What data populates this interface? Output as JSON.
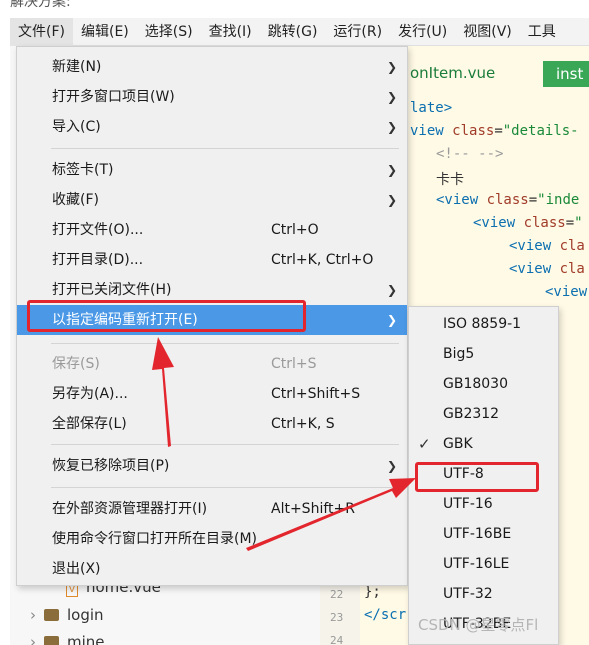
{
  "caption": "解决方案:",
  "menubar": [
    "文件(F)",
    "编辑(E)",
    "选择(S)",
    "查找(I)",
    "跳转(G)",
    "运行(R)",
    "发行(U)",
    "视图(V)",
    "工具"
  ],
  "editor": {
    "tab_title": "onItem.vue",
    "green_button": "inst",
    "code_lines": [
      {
        "parts": [
          {
            "c": "tag",
            "t": "late>"
          }
        ]
      },
      {
        "parts": [
          {
            "c": "tag",
            "t": "view "
          },
          {
            "c": "attr",
            "t": "class"
          },
          {
            "c": "plain",
            "t": "="
          },
          {
            "c": "str",
            "t": "\"details-"
          }
        ]
      },
      {
        "parts": [
          {
            "c": "cmt",
            "t": "<!--  -->"
          }
        ]
      },
      {
        "parts": [
          {
            "c": "plain",
            "t": "卡卡"
          }
        ]
      },
      {
        "parts": [
          {
            "c": "tag",
            "t": "<view "
          },
          {
            "c": "attr",
            "t": "class"
          },
          {
            "c": "plain",
            "t": "="
          },
          {
            "c": "str",
            "t": "\"inde"
          }
        ]
      },
      {
        "parts": [
          {
            "c": "tag",
            "t": "<view "
          },
          {
            "c": "attr",
            "t": "class"
          },
          {
            "c": "plain",
            "t": "="
          },
          {
            "c": "str",
            "t": "\""
          }
        ]
      },
      {
        "parts": [
          {
            "c": "tag",
            "t": "<view "
          },
          {
            "c": "attr",
            "t": "cla"
          }
        ]
      },
      {
        "parts": [
          {
            "c": "tag",
            "t": "<view "
          },
          {
            "c": "attr",
            "t": "cla"
          }
        ]
      },
      {
        "parts": [
          {
            "c": "tag",
            "t": "<view"
          }
        ]
      },
      {
        "parts": [
          {
            "c": "tag",
            "t": ">"
          }
        ]
      }
    ],
    "bottom_code": [
      {
        "num": "22",
        "text": "};"
      },
      {
        "num": "23",
        "text": "</scr"
      },
      {
        "num": "24",
        "text": ""
      }
    ]
  },
  "tree": {
    "file": "home.vue",
    "folders": [
      "login",
      "mine"
    ]
  },
  "file_menu": {
    "items": [
      {
        "label": "新建(N)",
        "shortcut": "",
        "arrow": true
      },
      {
        "label": "打开多窗口项目(W)",
        "shortcut": "",
        "arrow": true
      },
      {
        "label": "导入(C)",
        "shortcut": "",
        "arrow": true
      },
      {
        "label": "标签卡(T)",
        "shortcut": "",
        "arrow": true
      },
      {
        "label": "收藏(F)",
        "shortcut": "",
        "arrow": true
      },
      {
        "label": "打开文件(O)...",
        "shortcut": "Ctrl+O",
        "arrow": false
      },
      {
        "label": "打开目录(D)...",
        "shortcut": "Ctrl+K, Ctrl+O",
        "arrow": false
      },
      {
        "label": "打开已关闭文件(H)",
        "shortcut": "",
        "arrow": true
      },
      {
        "label": "以指定编码重新打开(E)",
        "shortcut": "",
        "arrow": true
      },
      {
        "label": "保存(S)",
        "shortcut": "Ctrl+S",
        "arrow": false
      },
      {
        "label": "另存为(A)...",
        "shortcut": "Ctrl+Shift+S",
        "arrow": false
      },
      {
        "label": "全部保存(L)",
        "shortcut": "Ctrl+K, S",
        "arrow": false
      },
      {
        "label": "恢复已移除项目(P)",
        "shortcut": "",
        "arrow": true
      },
      {
        "label": "在外部资源管理器打开(I)",
        "shortcut": "Alt+Shift+R",
        "arrow": false
      },
      {
        "label": "使用命令行窗口打开所在目录(M)",
        "shortcut": "",
        "arrow": false
      },
      {
        "label": "退出(X)",
        "shortcut": "",
        "arrow": false
      }
    ]
  },
  "encoding_menu": {
    "items": [
      "ISO 8859-1",
      "Big5",
      "GB18030",
      "GB2312",
      "GBK",
      "UTF-8",
      "UTF-16",
      "UTF-16BE",
      "UTF-16LE",
      "UTF-32",
      "UTF-32BE"
    ],
    "checked": "GBK",
    "annotated": "UTF-8"
  },
  "colors": {
    "highlight": "#4a98e6",
    "annotation_red": "#e3262d",
    "menu_bg": "#f0f0f0"
  },
  "watermark": "CSDN @星零点Fl"
}
